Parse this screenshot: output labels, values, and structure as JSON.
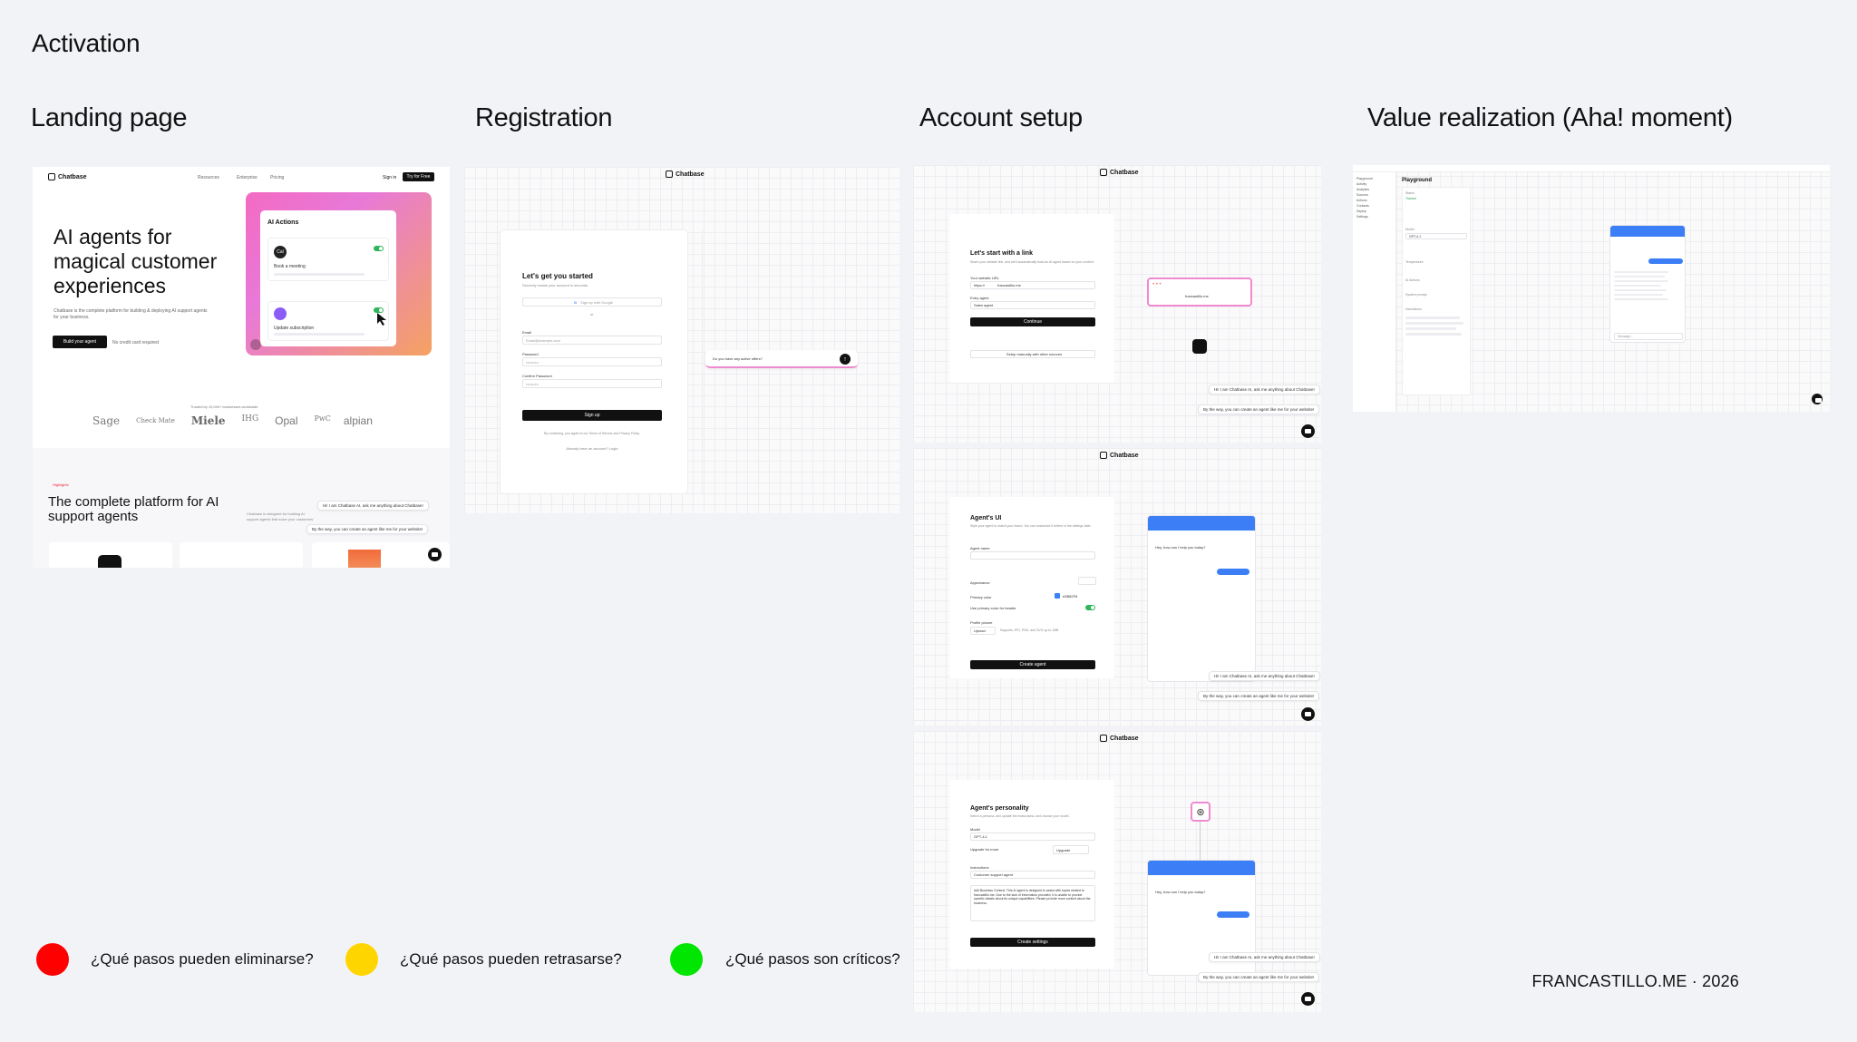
{
  "page_title": "Activation",
  "stages": [
    {
      "title": "Landing page"
    },
    {
      "title": "Registration"
    },
    {
      "title": "Account setup"
    },
    {
      "title": "Value realization (Aha! moment)"
    }
  ],
  "landing": {
    "brand": "Chatbase",
    "nav": [
      "Resources",
      "Enterprise",
      "Pricing"
    ],
    "sign_in": "Sign in",
    "try_free": "Try for Free",
    "hero_title": "AI agents for magical customer experiences",
    "hero_sub": "Chatbase is the complete platform for building & deploying AI support agents for your business.",
    "cta": "Build your agent",
    "no_card": "No credit card required",
    "actions_title": "AI Actions",
    "action_1": "Book a meeting",
    "action_2": "Update subscription",
    "trusted": "Trusted by 10,000+ businesses worldwide",
    "logos": [
      "Sage",
      "Check Mate",
      "Miele",
      "IHG",
      "Opal",
      "PwC",
      "alpian"
    ],
    "highlights": "Highlights",
    "section_title": "The complete platform for AI support agents",
    "section_sub": "Chatbase is designed for building AI support agents that solve your customers' hardest problems",
    "bubble_1": "Hi! I am Chatbase AI, ask me anything about Chatbase!",
    "bubble_2": "By the way, you can create an agent like me for your website!"
  },
  "registration": {
    "brand": "Chatbase",
    "title": "Let's get you started",
    "sub": "Securely create your account in seconds.",
    "google": "Sign up with Google",
    "or": "or",
    "email_label": "Email",
    "email_placeholder": "Email@example.com",
    "password_label": "Password",
    "confirm_label": "Confirm Password",
    "submit": "Sign up",
    "terms": "By continuing, you agree to our Terms of Service and Privacy Policy.",
    "login": "Already have an account? Login",
    "chat_prompt": "Do you have any active offers?"
  },
  "setup": {
    "brand": "Chatbase",
    "step1_title": "Let's start with a link",
    "step1_sub": "Share your website link, and we'll automatically build an AI agent based on your content.",
    "website_label": "Your website URL",
    "website_prefix": "https://",
    "website_value": "francastillo.me",
    "role_label": "Entry agent",
    "role_value": "Sales agent",
    "continue": "Continue",
    "manual": "Setup manually with other sources",
    "preview_url": "francastillo.me",
    "step2_title": "Agent's UI",
    "step2_sub": "Style your agent to match your brand. You can customize it further in the settings later.",
    "agent_name_label": "Agent name",
    "appearance_label": "Appearance",
    "primary_color_label": "Primary color",
    "primary_color_value": "#3B82F6",
    "use_primary": "Use primary color for header",
    "profile_label": "Profile picture",
    "upload": "Upload",
    "upload_hint": "Supports JPG, PNG, and SVG up to 1MB",
    "create_agent": "Create agent",
    "chat_greeting": "Hey, how can I help you today?",
    "chat_reply": "Hey, I need help",
    "step3_title": "Agent's personality",
    "step3_sub": "Select a persona, and update the instructions, and choose your model.",
    "model_label": "Model",
    "model_value": "GPT-4.1",
    "upgrade_note": "Upgrade for more",
    "upgrade_btn": "Upgrade",
    "instructions_label": "Instructions",
    "persona_value": "Customer support agent",
    "instructions_text": "### Business Context: This AI agent is designed to assist with topics related to francastillo.me. Due to the lack of information provided, it is unable to provide specific details about its unique capabilities. Please provide more context about the business.",
    "create_settings": "Create settings",
    "bubble_1": "Hi! I am Chatbase AI, ask me anything about Chatbase!",
    "bubble_2": "By the way, you can create an agent like me for your website!"
  },
  "value": {
    "breadcrumb": "Playground",
    "sidebar": [
      "Playground",
      "Activity",
      "Analytics",
      "Sources",
      "Actions",
      "Contacts",
      "Deploy",
      "Settings"
    ],
    "status_label": "Status",
    "status_value": "Trained",
    "model_label": "Model",
    "model_value": "GPT-4.1",
    "temperature_label": "Temperature",
    "ai_actions": "AI Actions",
    "system_prompt": "System prompt",
    "instructions": "Instructions",
    "chat_user": "Hey, I need help",
    "chat_bot": "Hi! What can I help you with?",
    "composer_placeholder": "Message..."
  },
  "legend": [
    {
      "color": "#ff0000",
      "label": "¿Qué pasos pueden eliminarse?"
    },
    {
      "color": "#ffd500",
      "label": "¿Qué pasos pueden retrasarse?"
    },
    {
      "color": "#00e600",
      "label": "¿Qué pasos son críticos?"
    }
  ],
  "signature": "FRANCASTILLO.ME · 2026"
}
